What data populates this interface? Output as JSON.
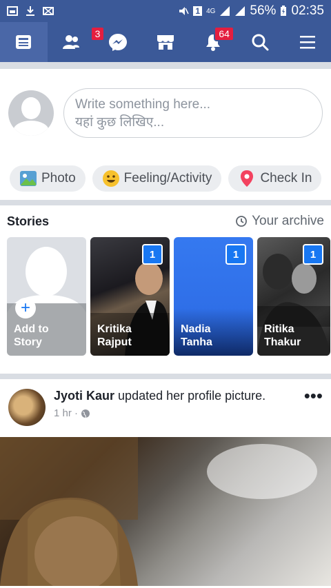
{
  "status_bar": {
    "battery": "56%",
    "time": "02:35",
    "network": "4G",
    "sim": "1",
    "colors": {
      "bg": "#3b5998"
    }
  },
  "nav": {
    "items": [
      {
        "icon": "news-feed-icon",
        "active": true
      },
      {
        "icon": "friends-icon",
        "badge": "3"
      },
      {
        "icon": "messenger-icon"
      },
      {
        "icon": "marketplace-icon"
      },
      {
        "icon": "notifications-icon",
        "badge": "64"
      },
      {
        "icon": "search-icon"
      },
      {
        "icon": "menu-icon"
      }
    ]
  },
  "composer": {
    "placeholder_line1": "Write something here...",
    "placeholder_line2": "यहां कुछ लिखिए..."
  },
  "actions": [
    {
      "label": "Photo",
      "icon": "photo-icon"
    },
    {
      "label": "Feeling/Activity",
      "icon": "smiley-icon"
    },
    {
      "label": "Check In",
      "icon": "location-pin-icon"
    }
  ],
  "stories": {
    "title": "Stories",
    "archive_label": "Your archive",
    "items": [
      {
        "label_line1": "Add to",
        "label_line2": "Story"
      },
      {
        "label_line1": "Kritika",
        "label_line2": "Rajput",
        "count": "1"
      },
      {
        "label_line1": "Nadia",
        "label_line2": "Tanha",
        "count": "1"
      },
      {
        "label_line1": "Ritika",
        "label_line2": "Thakur",
        "count": "1"
      }
    ]
  },
  "post": {
    "author": "Jyoti Kaur",
    "action": "updated her profile picture.",
    "time": "1 hr ·",
    "more": "•••"
  }
}
